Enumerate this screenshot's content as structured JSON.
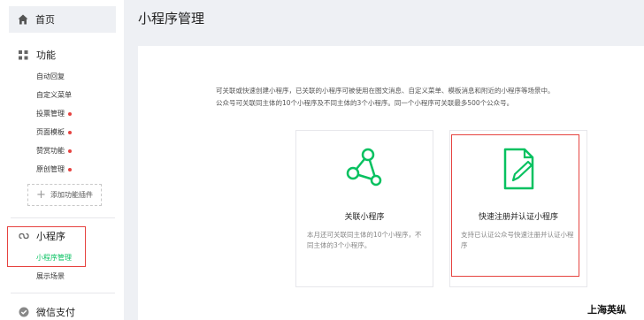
{
  "sidebar": {
    "home_label": "首页",
    "functions_label": "功能",
    "function_items": [
      {
        "label": "自动回复",
        "badge": false
      },
      {
        "label": "自定义菜单",
        "badge": false
      },
      {
        "label": "投票管理",
        "badge": true
      },
      {
        "label": "页面模板",
        "badge": true
      },
      {
        "label": "赞赏功能",
        "badge": true
      },
      {
        "label": "原创管理",
        "badge": true
      }
    ],
    "add_plugin_label": "添加功能插件",
    "miniprogram_label": "小程序",
    "miniprogram_items": [
      {
        "label": "小程序管理",
        "active": true
      },
      {
        "label": "展示场景",
        "active": false
      }
    ],
    "wechat_pay_label": "微信支付"
  },
  "page": {
    "title": "小程序管理",
    "description_line1": "可关联或快速创建小程序，已关联的小程序可被使用在图文消息、自定义菜单、模板消息和附近的小程序等场景中。",
    "description_line2": "公众号可关联同主体的10个小程序及不同主体的3个小程序。同一个小程序可关联最多500个公众号。"
  },
  "cards": [
    {
      "title": "关联小程序",
      "desc": "本月还可关联同主体的10个小程序，不同主体的3个小程序。",
      "icon": "link-nodes-icon"
    },
    {
      "title": "快速注册并认证小程序",
      "desc": "支持已认证公众号快速注册并认证小程序",
      "icon": "document-edit-icon"
    }
  ],
  "watermark": "上海英纵",
  "colors": {
    "accent": "#07c160",
    "highlight": "#e64340"
  }
}
